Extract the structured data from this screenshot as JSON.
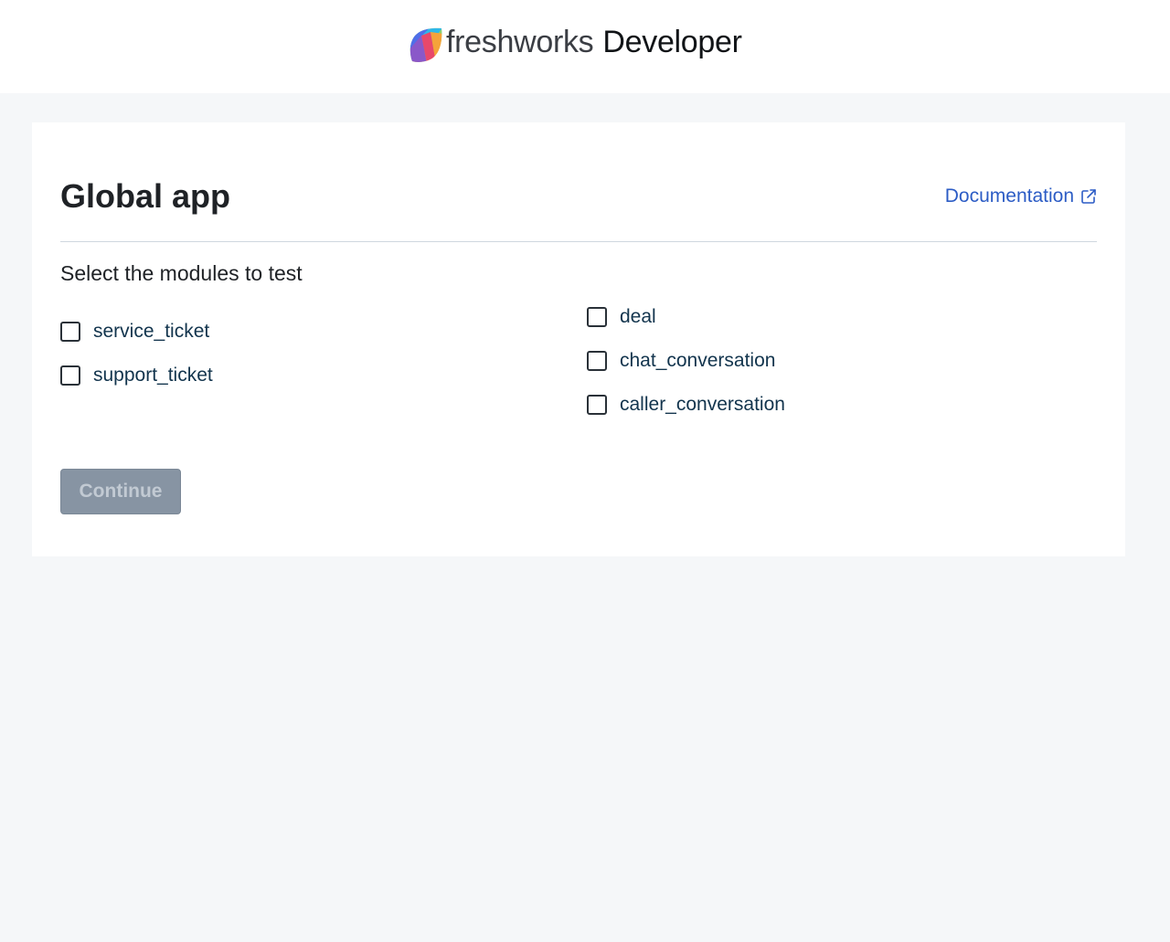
{
  "header": {
    "brand_name": "freshworks",
    "brand_suffix": "Developer",
    "logo_icon": "freshworks-leaf-logo"
  },
  "card": {
    "title": "Global app",
    "doc_link": {
      "label": "Documentation",
      "icon": "external-link-icon",
      "color": "#2c5cc5"
    },
    "subtitle": "Select the modules to test",
    "modules_left": [
      {
        "label": "service_ticket",
        "checked": false
      },
      {
        "label": "support_ticket",
        "checked": false
      }
    ],
    "modules_right": [
      {
        "label": "deal",
        "checked": false
      },
      {
        "label": "chat_conversation",
        "checked": false
      },
      {
        "label": "caller_conversation",
        "checked": false
      }
    ],
    "continue_label": "Continue",
    "continue_disabled": true
  },
  "colors": {
    "page_background": "#f5f7f9",
    "card_background": "#ffffff",
    "button_disabled": "#8794a3",
    "link": "#2c5cc5"
  }
}
